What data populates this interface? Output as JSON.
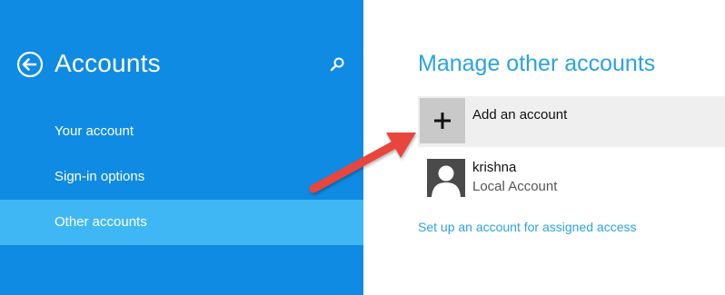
{
  "sidebar": {
    "title": "Accounts",
    "back_icon": "back-arrow-circle-icon",
    "search_icon": "search-icon",
    "items": [
      {
        "label": "Your account",
        "selected": false
      },
      {
        "label": "Sign-in options",
        "selected": false
      },
      {
        "label": "Other accounts",
        "selected": true
      }
    ]
  },
  "main": {
    "title": "Manage other accounts",
    "add_account": {
      "label": "Add an account",
      "icon": "plus-icon"
    },
    "users": [
      {
        "name": "krishna",
        "type": "Local Account",
        "icon": "user-avatar-icon"
      }
    ],
    "assigned_access_link": "Set up an account for assigned access"
  },
  "colors": {
    "sidebar_bg": "#0f8be3",
    "sidebar_selected": "#3fb7f5",
    "accent_text": "#2ba3df",
    "annotation_arrow": "#e8453c"
  }
}
